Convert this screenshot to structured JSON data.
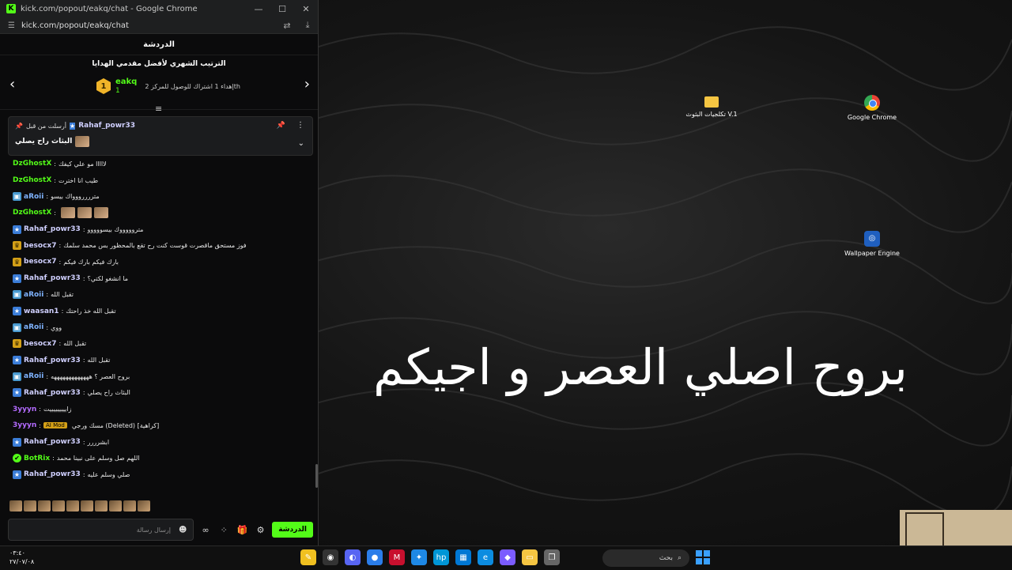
{
  "window": {
    "title": "kick.com/popout/eakq/chat - Google Chrome",
    "url": "kick.com/popout/eakq/chat"
  },
  "chat": {
    "header": "الدردشة",
    "leaderboard_title": "الترتيب الشهري لأفضل مقدمي الهدايا",
    "leader_rank": "1",
    "leader_name": "eakq",
    "leader_count": "1",
    "leader_next": "إهداء 1 اشتراك للوصول للمركز 2th"
  },
  "pinned": {
    "label": "أرسلت من قبل",
    "user": "Rahaf_powr33",
    "message": "البثاث راح يصلي"
  },
  "messages": [
    {
      "user": "DzGhostX",
      "color": "#53fc18",
      "icon": "",
      "text": "لااااا مو علي كيفك"
    },
    {
      "user": "DzGhostX",
      "color": "#53fc18",
      "icon": "",
      "text": "طيب انا اخترت"
    },
    {
      "user": "aRoii",
      "color": "#7fb3ff",
      "icon": "sub",
      "text": "متررررووواك بيسو"
    },
    {
      "user": "DzGhostX",
      "color": "#53fc18",
      "icon": "",
      "text": ""
    },
    {
      "user": "Rahaf_powr33",
      "color": "#d0d0ff",
      "icon": "vip",
      "text": "متروووووك بيسووووو"
    },
    {
      "user": "besocx7",
      "color": "#d0d0ff",
      "icon": "crown",
      "text": "فوز مستحق ماقصرت قوست كنت رح تقع بالمحظور بس محمد سلمك"
    },
    {
      "user": "besocx7",
      "color": "#d0d0ff",
      "icon": "crown",
      "text": "بارك فيكم بارك فيكم"
    },
    {
      "user": "Rahaf_powr33",
      "color": "#d0d0ff",
      "icon": "vip",
      "text": "ما انشغو لكتي؟"
    },
    {
      "user": "aRoii",
      "color": "#7fb3ff",
      "icon": "sub",
      "text": "تقبل الله"
    },
    {
      "user": "waasan1",
      "color": "#d0d0ff",
      "icon": "vip",
      "text": "تقبل الله خذ راحتك"
    },
    {
      "user": "aRoii",
      "color": "#7fb3ff",
      "icon": "sub",
      "text": "ووي"
    },
    {
      "user": "besocx7",
      "color": "#d0d0ff",
      "icon": "crown",
      "text": "تقبل الله"
    },
    {
      "user": "Rahaf_powr33",
      "color": "#d0d0ff",
      "icon": "vip",
      "text": "تقبل الله"
    },
    {
      "user": "aRoii",
      "color": "#7fb3ff",
      "icon": "sub",
      "text": "بروح العصر ؟ هههههههههههههه"
    },
    {
      "user": "Rahaf_powr33",
      "color": "#d0d0ff",
      "icon": "vip",
      "text": "البثاث راح يصلي"
    },
    {
      "user": "3yyyn",
      "color": "#b36bff",
      "icon": "",
      "text": "زايييييييييت"
    },
    {
      "user": "3yyyn",
      "color": "#b36bff",
      "icon": "",
      "text": "مسك ورجي (Deleted) [كراهية]"
    },
    {
      "user": "Rahaf_powr33",
      "color": "#d0d0ff",
      "icon": "vip",
      "text": "ابشرررر"
    },
    {
      "user": "BotRix",
      "color": "#53fc18",
      "icon": "bot",
      "text": "اللهم صل وسلم على نبينا محمد"
    },
    {
      "user": "Rahaf_powr33",
      "color": "#d0d0ff",
      "icon": "vip",
      "text": "صلي وسلم عليه"
    }
  ],
  "mod_tag": "AI Mod",
  "input": {
    "placeholder": "إرسال رسالة",
    "send_label": "الدردشة"
  },
  "desktop": {
    "folder_label": "تكلجيات البثوث V.1",
    "chrome_label": "Google Chrome",
    "wallpaper_label": "Wallpaper Engine",
    "overlay_text": "بروح اصلي العصر و اجيكم"
  },
  "taskbar": {
    "time": "٠٣:٤٠",
    "date": "٢٧/٠٧/٠٨",
    "search_label": "بحث"
  }
}
